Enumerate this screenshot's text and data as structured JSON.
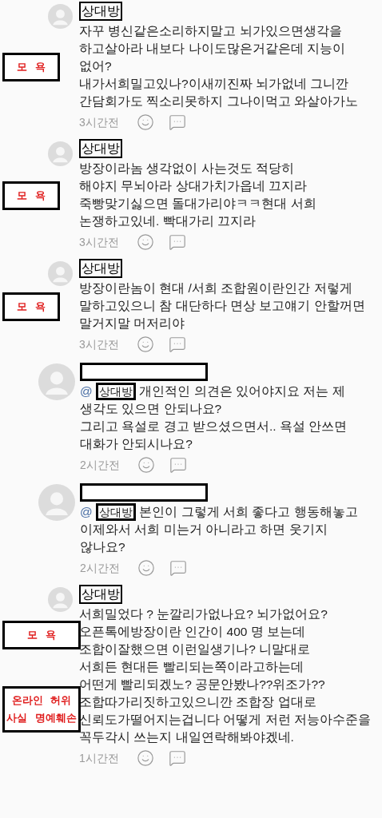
{
  "comments": [
    {
      "kind": "comment",
      "author": "상대방",
      "lines": [
        "자꾸 병신같은소리하지말고 뇌가있으면생각을",
        "하고살아라 내보다 나이도많은거같은데 지능이",
        "없어?",
        "내가서희밀고있나?이새끼진짜 뇌가없네 그니깐",
        "간담회가도 찍소리못하지 그나이먹고 와살아가노"
      ],
      "time": "3시간전",
      "annotations": [
        {
          "lines": [
            "모 욕"
          ]
        }
      ]
    },
    {
      "kind": "comment",
      "author": "상대방",
      "lines": [
        "방장이라놈  생각없이 사는것도 적당히",
        "해야지 무뇌아라 상대가치가읍네 끄지라",
        "죽빵맞기싫으면 돌대가리야ㅋㅋ현대 서희",
        "논쟁하고있네.  빡대가리 끄지라"
      ],
      "time": "3시간전",
      "annotations": [
        {
          "lines": [
            "모 욕"
          ]
        }
      ]
    },
    {
      "kind": "comment",
      "author": "상대방",
      "lines": [
        "방장이란놈이 현대 /서희 조합원이란인간 저렇게",
        "말하고있으니 참 대단하다 면상 보고얘기 안할꺼면",
        "말거지말 머저리야"
      ],
      "time": "3시간전",
      "annotations": [
        {
          "lines": [
            "모 욕"
          ]
        }
      ]
    },
    {
      "kind": "reply",
      "at": "@",
      "mention": "상대방",
      "lines": [
        "개인적인 의견은 있어야지요 저는 제",
        "생각도 있으면 안되나요?",
        "그리고 욕설로 경고 받으셨으면서.. 욕설 안쓰면",
        "대화가 안되시나요?"
      ],
      "time": "2시간전"
    },
    {
      "kind": "reply",
      "at": "@",
      "mention": "상대방",
      "lines": [
        "본인이 그렇게 서희 좋다고 행동해놓고",
        "이제와서 서희 미는거 아니라고 하면 웃기지",
        "않나요?"
      ],
      "time": "2시간전"
    },
    {
      "kind": "comment",
      "author": "상대방",
      "lines": [
        "서희밀었다 ? 눈깔리가없나요? 뇌가없어요?",
        "오픈톡에방장이란 인간이 400 명 보는데",
        "조합이잘했으면 이런일생기나? 니말대로",
        "서희든 현대든 빨리되는쪽이라고하는데",
        "어떤게 빨리되겠노? 공문안봤나??위조가??",
        "조합따가리짓하고있으니깐 조합장 업대로",
        "신뢰도가떨어지는겁니다 어떻게 저런 저능아수준을",
        "꼭두각시 쓰는지 내일연락해봐야겠네."
      ],
      "time": "1시간전",
      "annotations": [
        {
          "lines": [
            "모 욕"
          ]
        },
        {
          "lines": [
            "온라인 허위",
            "사실 명예훼손"
          ]
        }
      ]
    }
  ]
}
